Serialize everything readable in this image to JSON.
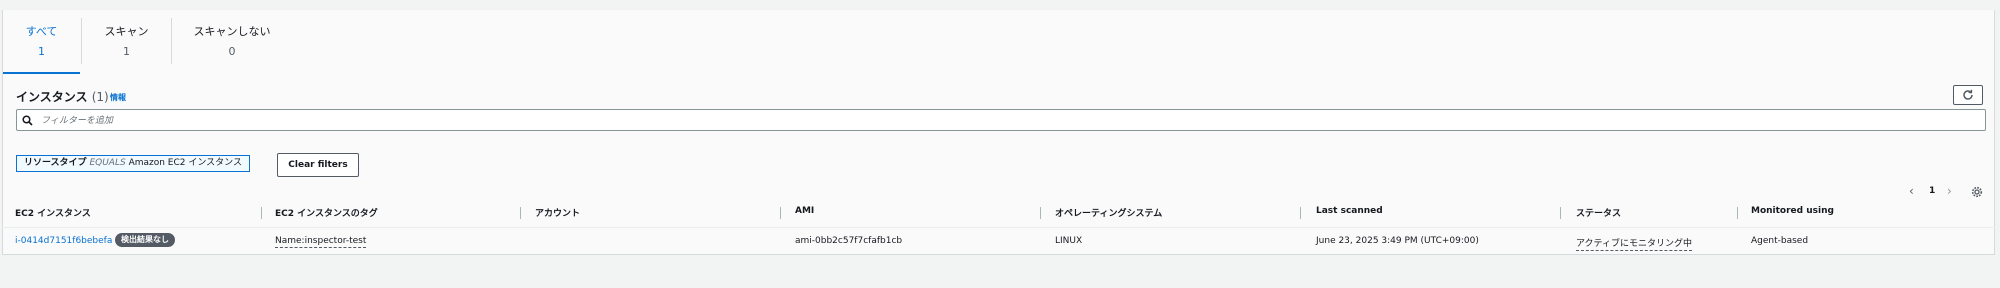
{
  "tabs": [
    {
      "label": "すべて",
      "count": "1"
    },
    {
      "label": "スキャン",
      "count": "1"
    },
    {
      "label": "スキャンしない",
      "count": "0"
    }
  ],
  "header": {
    "title": "インスタンス",
    "count": "(1)",
    "info": "情報"
  },
  "search": {
    "placeholder": "フィルターを追加"
  },
  "filter_token": {
    "key": "リソースタイプ",
    "operator": "EQUALS",
    "value": "Amazon EC2 インスタンス"
  },
  "clear_filters_label": "Clear filters",
  "pagination": {
    "page": "1"
  },
  "columns": [
    "EC2 インスタンス",
    "EC2 インスタンスのタグ",
    "アカウント",
    "AMI",
    "オペレーティングシステム",
    "Last scanned",
    "ステータス",
    "Monitored using"
  ],
  "rows": [
    {
      "instance_id": "i-0414d7151f6bebefa",
      "badge": "検出結果なし",
      "tag": "Name:inspector-test",
      "account": "",
      "ami": "ami-0bb2c57f7cfafb1cb",
      "os": "LINUX",
      "last_scanned": "June 23, 2025 3:49 PM (UTC+09:00)",
      "status": "アクティブにモニタリング中",
      "monitored_using": "Agent-based"
    }
  ],
  "icons": {
    "refresh": "refresh-icon",
    "search": "search-icon",
    "prev": "chevron-left-icon",
    "next": "chevron-right-icon",
    "settings": "gear-icon"
  },
  "colors": {
    "accent": "#0972d3",
    "badge_bg": "#545b64"
  }
}
